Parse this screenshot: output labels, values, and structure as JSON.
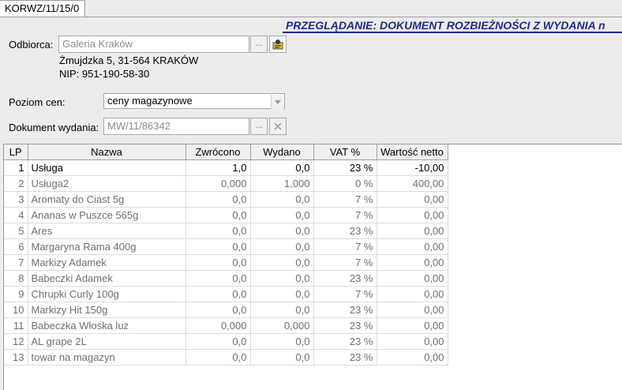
{
  "tab": {
    "label": "KORWZ/11/15/0"
  },
  "header": {
    "title": "PRZEGLĄDANIE: DOKUMENT ROZBIEŻNOŚCI Z WYDANIA n"
  },
  "recipient": {
    "label": "Odbiorca:",
    "value": "Galeria Kraków",
    "address": "Żmujdzka 5, 31-564 KRAKÓW",
    "nip": "NIP: 951-190-58-30",
    "browse_button": "...",
    "browse_icon": "ellipsis-icon",
    "contact_icon": "contact-card-icon"
  },
  "price_level": {
    "label": "Poziom cen:",
    "value": "ceny magazynowe"
  },
  "issue_document": {
    "label": "Dokument wydania:",
    "value": "MW/11/86342",
    "browse_button": "...",
    "clear_icon": "clear-x-icon"
  },
  "grid": {
    "columns": [
      "LP",
      "Nazwa",
      "Zwrócono",
      "Wydano",
      "VAT %",
      "Wartość netto"
    ],
    "rows": [
      {
        "lp": "1",
        "name": "Usługa",
        "returned": "1,0",
        "issued": "0,0",
        "vat": "23 %",
        "net": "-10,00"
      },
      {
        "lp": "2",
        "name": "Usługa2",
        "returned": "0,000",
        "issued": "1,000",
        "vat": "0 %",
        "net": "400,00"
      },
      {
        "lp": "3",
        "name": "Aromaty do Ciast 5g",
        "returned": "0,0",
        "issued": "0,0",
        "vat": "7 %",
        "net": "0,00"
      },
      {
        "lp": "4",
        "name": "Ananas w Puszce 565g",
        "returned": "0,0",
        "issued": "0,0",
        "vat": "7 %",
        "net": "0,00"
      },
      {
        "lp": "5",
        "name": "Ares",
        "returned": "0,0",
        "issued": "0,0",
        "vat": "23 %",
        "net": "0,00"
      },
      {
        "lp": "6",
        "name": "Margaryna Rama 400g",
        "returned": "0,0",
        "issued": "0,0",
        "vat": "7 %",
        "net": "0,00"
      },
      {
        "lp": "7",
        "name": "Markizy Adamek",
        "returned": "0,0",
        "issued": "0,0",
        "vat": "7 %",
        "net": "0,00"
      },
      {
        "lp": "8",
        "name": "Babeczki Adamek",
        "returned": "0,0",
        "issued": "0,0",
        "vat": "23 %",
        "net": "0,00"
      },
      {
        "lp": "9",
        "name": "Chrupki Curly 100g",
        "returned": "0,0",
        "issued": "0,0",
        "vat": "7 %",
        "net": "0,00"
      },
      {
        "lp": "10",
        "name": "Markizy Hit 150g",
        "returned": "0,0",
        "issued": "0,0",
        "vat": "23 %",
        "net": "0,00"
      },
      {
        "lp": "11",
        "name": "Babeczka Włoska luz",
        "returned": "0,000",
        "issued": "0,000",
        "vat": "23 %",
        "net": "0,00"
      },
      {
        "lp": "12",
        "name": "AL grape 2L",
        "returned": "0,0",
        "issued": "0,0",
        "vat": "23 %",
        "net": "0,00"
      },
      {
        "lp": "13",
        "name": "towar na magazyn",
        "returned": "0,0",
        "issued": "0,0",
        "vat": "23 %",
        "net": "0,00"
      }
    ]
  }
}
